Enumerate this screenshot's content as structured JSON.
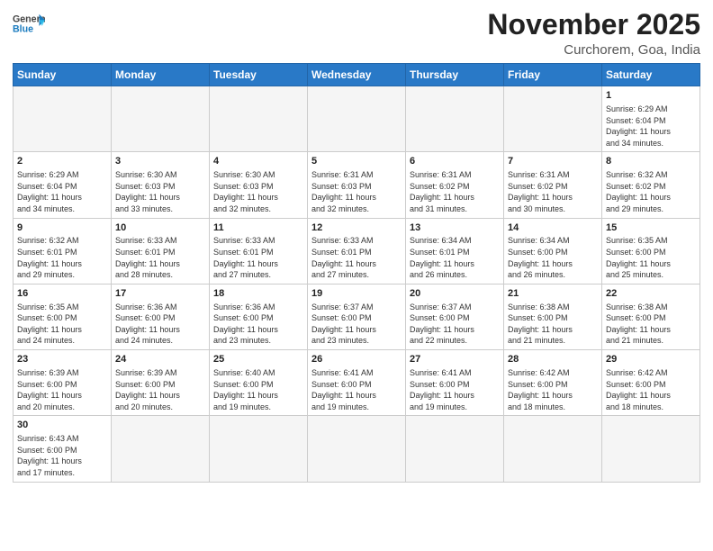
{
  "header": {
    "logo_general": "General",
    "logo_blue": "Blue",
    "month_title": "November 2025",
    "subtitle": "Curchorem, Goa, India"
  },
  "weekdays": [
    "Sunday",
    "Monday",
    "Tuesday",
    "Wednesday",
    "Thursday",
    "Friday",
    "Saturday"
  ],
  "weeks": [
    [
      {
        "day": "",
        "info": ""
      },
      {
        "day": "",
        "info": ""
      },
      {
        "day": "",
        "info": ""
      },
      {
        "day": "",
        "info": ""
      },
      {
        "day": "",
        "info": ""
      },
      {
        "day": "",
        "info": ""
      },
      {
        "day": "1",
        "info": "Sunrise: 6:29 AM\nSunset: 6:04 PM\nDaylight: 11 hours\nand 34 minutes."
      }
    ],
    [
      {
        "day": "2",
        "info": "Sunrise: 6:29 AM\nSunset: 6:04 PM\nDaylight: 11 hours\nand 34 minutes."
      },
      {
        "day": "3",
        "info": "Sunrise: 6:30 AM\nSunset: 6:03 PM\nDaylight: 11 hours\nand 33 minutes."
      },
      {
        "day": "4",
        "info": "Sunrise: 6:30 AM\nSunset: 6:03 PM\nDaylight: 11 hours\nand 32 minutes."
      },
      {
        "day": "5",
        "info": "Sunrise: 6:31 AM\nSunset: 6:03 PM\nDaylight: 11 hours\nand 32 minutes."
      },
      {
        "day": "6",
        "info": "Sunrise: 6:31 AM\nSunset: 6:02 PM\nDaylight: 11 hours\nand 31 minutes."
      },
      {
        "day": "7",
        "info": "Sunrise: 6:31 AM\nSunset: 6:02 PM\nDaylight: 11 hours\nand 30 minutes."
      },
      {
        "day": "8",
        "info": "Sunrise: 6:32 AM\nSunset: 6:02 PM\nDaylight: 11 hours\nand 29 minutes."
      }
    ],
    [
      {
        "day": "9",
        "info": "Sunrise: 6:32 AM\nSunset: 6:01 PM\nDaylight: 11 hours\nand 29 minutes."
      },
      {
        "day": "10",
        "info": "Sunrise: 6:33 AM\nSunset: 6:01 PM\nDaylight: 11 hours\nand 28 minutes."
      },
      {
        "day": "11",
        "info": "Sunrise: 6:33 AM\nSunset: 6:01 PM\nDaylight: 11 hours\nand 27 minutes."
      },
      {
        "day": "12",
        "info": "Sunrise: 6:33 AM\nSunset: 6:01 PM\nDaylight: 11 hours\nand 27 minutes."
      },
      {
        "day": "13",
        "info": "Sunrise: 6:34 AM\nSunset: 6:01 PM\nDaylight: 11 hours\nand 26 minutes."
      },
      {
        "day": "14",
        "info": "Sunrise: 6:34 AM\nSunset: 6:00 PM\nDaylight: 11 hours\nand 26 minutes."
      },
      {
        "day": "15",
        "info": "Sunrise: 6:35 AM\nSunset: 6:00 PM\nDaylight: 11 hours\nand 25 minutes."
      }
    ],
    [
      {
        "day": "16",
        "info": "Sunrise: 6:35 AM\nSunset: 6:00 PM\nDaylight: 11 hours\nand 24 minutes."
      },
      {
        "day": "17",
        "info": "Sunrise: 6:36 AM\nSunset: 6:00 PM\nDaylight: 11 hours\nand 24 minutes."
      },
      {
        "day": "18",
        "info": "Sunrise: 6:36 AM\nSunset: 6:00 PM\nDaylight: 11 hours\nand 23 minutes."
      },
      {
        "day": "19",
        "info": "Sunrise: 6:37 AM\nSunset: 6:00 PM\nDaylight: 11 hours\nand 23 minutes."
      },
      {
        "day": "20",
        "info": "Sunrise: 6:37 AM\nSunset: 6:00 PM\nDaylight: 11 hours\nand 22 minutes."
      },
      {
        "day": "21",
        "info": "Sunrise: 6:38 AM\nSunset: 6:00 PM\nDaylight: 11 hours\nand 21 minutes."
      },
      {
        "day": "22",
        "info": "Sunrise: 6:38 AM\nSunset: 6:00 PM\nDaylight: 11 hours\nand 21 minutes."
      }
    ],
    [
      {
        "day": "23",
        "info": "Sunrise: 6:39 AM\nSunset: 6:00 PM\nDaylight: 11 hours\nand 20 minutes."
      },
      {
        "day": "24",
        "info": "Sunrise: 6:39 AM\nSunset: 6:00 PM\nDaylight: 11 hours\nand 20 minutes."
      },
      {
        "day": "25",
        "info": "Sunrise: 6:40 AM\nSunset: 6:00 PM\nDaylight: 11 hours\nand 19 minutes."
      },
      {
        "day": "26",
        "info": "Sunrise: 6:41 AM\nSunset: 6:00 PM\nDaylight: 11 hours\nand 19 minutes."
      },
      {
        "day": "27",
        "info": "Sunrise: 6:41 AM\nSunset: 6:00 PM\nDaylight: 11 hours\nand 19 minutes."
      },
      {
        "day": "28",
        "info": "Sunrise: 6:42 AM\nSunset: 6:00 PM\nDaylight: 11 hours\nand 18 minutes."
      },
      {
        "day": "29",
        "info": "Sunrise: 6:42 AM\nSunset: 6:00 PM\nDaylight: 11 hours\nand 18 minutes."
      }
    ],
    [
      {
        "day": "30",
        "info": "Sunrise: 6:43 AM\nSunset: 6:00 PM\nDaylight: 11 hours\nand 17 minutes."
      },
      {
        "day": "",
        "info": ""
      },
      {
        "day": "",
        "info": ""
      },
      {
        "day": "",
        "info": ""
      },
      {
        "day": "",
        "info": ""
      },
      {
        "day": "",
        "info": ""
      },
      {
        "day": "",
        "info": ""
      }
    ]
  ]
}
